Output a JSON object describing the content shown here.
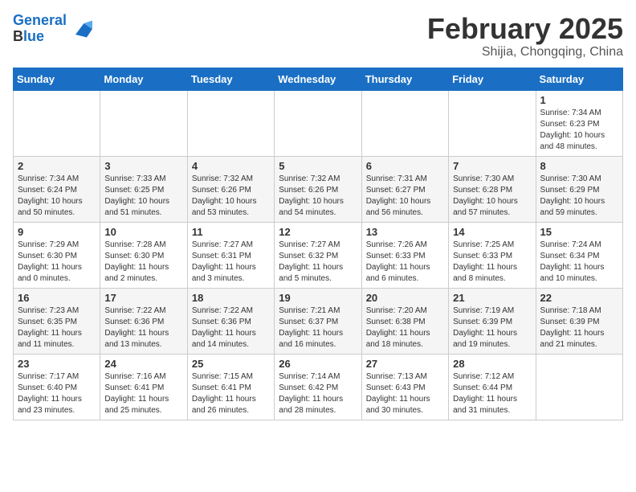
{
  "header": {
    "logo_line1": "General",
    "logo_line2": "Blue",
    "month_title": "February 2025",
    "location": "Shijia, Chongqing, China"
  },
  "weekdays": [
    "Sunday",
    "Monday",
    "Tuesday",
    "Wednesday",
    "Thursday",
    "Friday",
    "Saturday"
  ],
  "weeks": [
    [
      {
        "day": "",
        "detail": ""
      },
      {
        "day": "",
        "detail": ""
      },
      {
        "day": "",
        "detail": ""
      },
      {
        "day": "",
        "detail": ""
      },
      {
        "day": "",
        "detail": ""
      },
      {
        "day": "",
        "detail": ""
      },
      {
        "day": "1",
        "detail": "Sunrise: 7:34 AM\nSunset: 6:23 PM\nDaylight: 10 hours\nand 48 minutes."
      }
    ],
    [
      {
        "day": "2",
        "detail": "Sunrise: 7:34 AM\nSunset: 6:24 PM\nDaylight: 10 hours\nand 50 minutes."
      },
      {
        "day": "3",
        "detail": "Sunrise: 7:33 AM\nSunset: 6:25 PM\nDaylight: 10 hours\nand 51 minutes."
      },
      {
        "day": "4",
        "detail": "Sunrise: 7:32 AM\nSunset: 6:26 PM\nDaylight: 10 hours\nand 53 minutes."
      },
      {
        "day": "5",
        "detail": "Sunrise: 7:32 AM\nSunset: 6:26 PM\nDaylight: 10 hours\nand 54 minutes."
      },
      {
        "day": "6",
        "detail": "Sunrise: 7:31 AM\nSunset: 6:27 PM\nDaylight: 10 hours\nand 56 minutes."
      },
      {
        "day": "7",
        "detail": "Sunrise: 7:30 AM\nSunset: 6:28 PM\nDaylight: 10 hours\nand 57 minutes."
      },
      {
        "day": "8",
        "detail": "Sunrise: 7:30 AM\nSunset: 6:29 PM\nDaylight: 10 hours\nand 59 minutes."
      }
    ],
    [
      {
        "day": "9",
        "detail": "Sunrise: 7:29 AM\nSunset: 6:30 PM\nDaylight: 11 hours\nand 0 minutes."
      },
      {
        "day": "10",
        "detail": "Sunrise: 7:28 AM\nSunset: 6:30 PM\nDaylight: 11 hours\nand 2 minutes."
      },
      {
        "day": "11",
        "detail": "Sunrise: 7:27 AM\nSunset: 6:31 PM\nDaylight: 11 hours\nand 3 minutes."
      },
      {
        "day": "12",
        "detail": "Sunrise: 7:27 AM\nSunset: 6:32 PM\nDaylight: 11 hours\nand 5 minutes."
      },
      {
        "day": "13",
        "detail": "Sunrise: 7:26 AM\nSunset: 6:33 PM\nDaylight: 11 hours\nand 6 minutes."
      },
      {
        "day": "14",
        "detail": "Sunrise: 7:25 AM\nSunset: 6:33 PM\nDaylight: 11 hours\nand 8 minutes."
      },
      {
        "day": "15",
        "detail": "Sunrise: 7:24 AM\nSunset: 6:34 PM\nDaylight: 11 hours\nand 10 minutes."
      }
    ],
    [
      {
        "day": "16",
        "detail": "Sunrise: 7:23 AM\nSunset: 6:35 PM\nDaylight: 11 hours\nand 11 minutes."
      },
      {
        "day": "17",
        "detail": "Sunrise: 7:22 AM\nSunset: 6:36 PM\nDaylight: 11 hours\nand 13 minutes."
      },
      {
        "day": "18",
        "detail": "Sunrise: 7:22 AM\nSunset: 6:36 PM\nDaylight: 11 hours\nand 14 minutes."
      },
      {
        "day": "19",
        "detail": "Sunrise: 7:21 AM\nSunset: 6:37 PM\nDaylight: 11 hours\nand 16 minutes."
      },
      {
        "day": "20",
        "detail": "Sunrise: 7:20 AM\nSunset: 6:38 PM\nDaylight: 11 hours\nand 18 minutes."
      },
      {
        "day": "21",
        "detail": "Sunrise: 7:19 AM\nSunset: 6:39 PM\nDaylight: 11 hours\nand 19 minutes."
      },
      {
        "day": "22",
        "detail": "Sunrise: 7:18 AM\nSunset: 6:39 PM\nDaylight: 11 hours\nand 21 minutes."
      }
    ],
    [
      {
        "day": "23",
        "detail": "Sunrise: 7:17 AM\nSunset: 6:40 PM\nDaylight: 11 hours\nand 23 minutes."
      },
      {
        "day": "24",
        "detail": "Sunrise: 7:16 AM\nSunset: 6:41 PM\nDaylight: 11 hours\nand 25 minutes."
      },
      {
        "day": "25",
        "detail": "Sunrise: 7:15 AM\nSunset: 6:41 PM\nDaylight: 11 hours\nand 26 minutes."
      },
      {
        "day": "26",
        "detail": "Sunrise: 7:14 AM\nSunset: 6:42 PM\nDaylight: 11 hours\nand 28 minutes."
      },
      {
        "day": "27",
        "detail": "Sunrise: 7:13 AM\nSunset: 6:43 PM\nDaylight: 11 hours\nand 30 minutes."
      },
      {
        "day": "28",
        "detail": "Sunrise: 7:12 AM\nSunset: 6:44 PM\nDaylight: 11 hours\nand 31 minutes."
      },
      {
        "day": "",
        "detail": ""
      }
    ]
  ]
}
